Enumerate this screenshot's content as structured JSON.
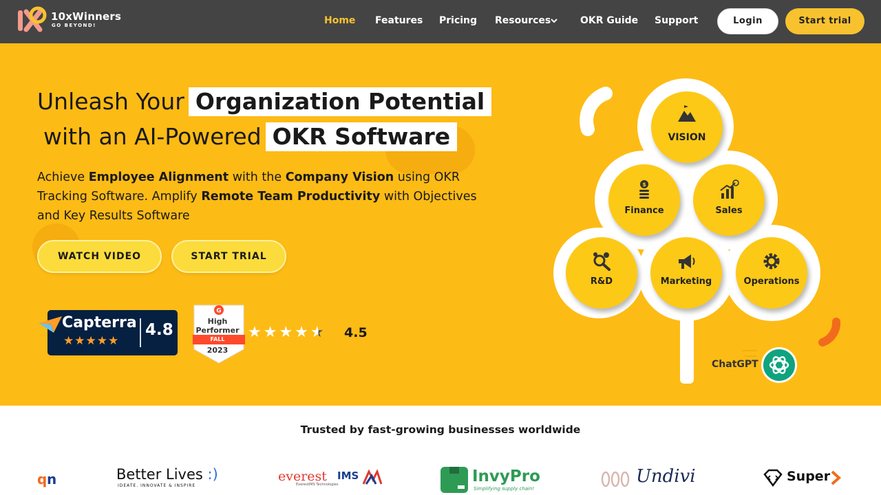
{
  "navbar": {
    "logo_name": "10xWinners",
    "logo_tagline": "GO BEYOND!",
    "links": [
      "Home",
      "Features",
      "Pricing",
      "Resources",
      "OKR Guide",
      "Support"
    ],
    "active_link": "Home",
    "login_label": "Login",
    "start_trial_label": "Start trial"
  },
  "hero": {
    "headline_line1_plain": "Unleash Your",
    "headline_line1_highlight": "Organization Potential",
    "headline_line2_plain": "with an AI-Powered",
    "headline_line2_highlight": "OKR Software",
    "subtitle_parts": {
      "p1": "Achieve ",
      "b1": "Employee Alignment",
      "p2": " with the ",
      "b2": "Company Vision",
      "p3": " using OKR Tracking Software. Amplify ",
      "b3": "Remote Team Productivity",
      "p4": " with Objectives and Key Results Software"
    },
    "watch_video_label": "WATCH VIDEO",
    "start_trial_label": "START TRIAL",
    "capterra": {
      "name": "Capterra",
      "score": "4.8",
      "stars": "★★★★★"
    },
    "g2": {
      "high": "High",
      "performer": "Performer",
      "season": "FALL",
      "year": "2023",
      "stars": "★★★★",
      "score": "4.5"
    },
    "colors": {
      "hero_bg": "#fdbb15",
      "node": "#fcc917",
      "accent": "#f8c22f"
    }
  },
  "tree": {
    "nodes": [
      {
        "label": "VISION",
        "icon": "mountain-flag-icon"
      },
      {
        "label": "Finance",
        "icon": "dollar-coins-icon"
      },
      {
        "label": "Sales",
        "icon": "bar-growth-icon"
      },
      {
        "label": "R&D",
        "icon": "research-magnifier-icon"
      },
      {
        "label": "Marketing",
        "icon": "megaphone-icon"
      },
      {
        "label": "Operations",
        "icon": "gears-icon"
      }
    ],
    "chatgpt_label": "ChatGPT"
  },
  "trusted": {
    "heading": "Trusted by fast-growing businesses worldwide",
    "brands": {
      "betterlives": "Better Lives",
      "betterlives_smile": ":)",
      "betterlives_tag": "IDEATE. INNOVATE & INSPIRE",
      "everest": "everest",
      "everest_ims": "IMS",
      "everest_tag": "EverestIMS Technologies",
      "invypro": "InvyPro",
      "invypro_tag": "Simplifying supply chain!",
      "undivi": "Undivi",
      "super": "Super"
    }
  }
}
